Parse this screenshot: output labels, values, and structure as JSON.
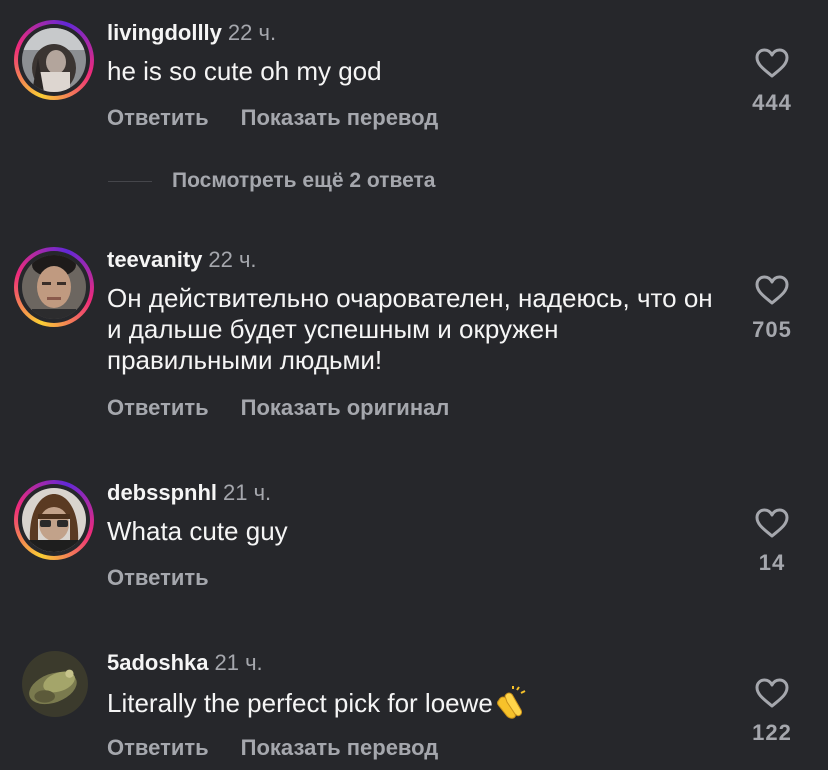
{
  "comments": [
    {
      "username": "livingdollly",
      "time": "22 ч.",
      "text": "he is so cute oh my god",
      "actions": [
        "Ответить",
        "Показать перевод"
      ],
      "likes": "444",
      "avatar": "avatar-photo-dark-hair"
    },
    {
      "username": "teevanity",
      "time": "22 ч.",
      "text": "Он действительно очарователен, надеюсь, что он и дальше будет успешным и окружен правильными людьми!",
      "actions": [
        "Ответить",
        "Показать оригинал"
      ],
      "likes": "705",
      "avatar": "avatar-photo-face"
    },
    {
      "username": "debsspnhl",
      "time": "21 ч.",
      "text": "Whata cute guy",
      "actions": [
        "Ответить"
      ],
      "likes": "14",
      "avatar": "avatar-photo-bob-hair-glasses"
    },
    {
      "username": "5adoshka",
      "time": "21 ч.",
      "text": "Literally the perfect pick for loewe",
      "emoji": "clapping-hands-icon",
      "actions": [
        "Ответить",
        "Показать перевод"
      ],
      "likes": "122",
      "avatar": "avatar-photo-moss"
    }
  ],
  "more_replies": {
    "label": "Посмотреть ещё 2 ответа"
  },
  "colors": {
    "background": "#26272b",
    "text_primary": "#f5f5f5",
    "text_secondary": "#a5a7ad",
    "story_ring": "#ee2a7b"
  }
}
